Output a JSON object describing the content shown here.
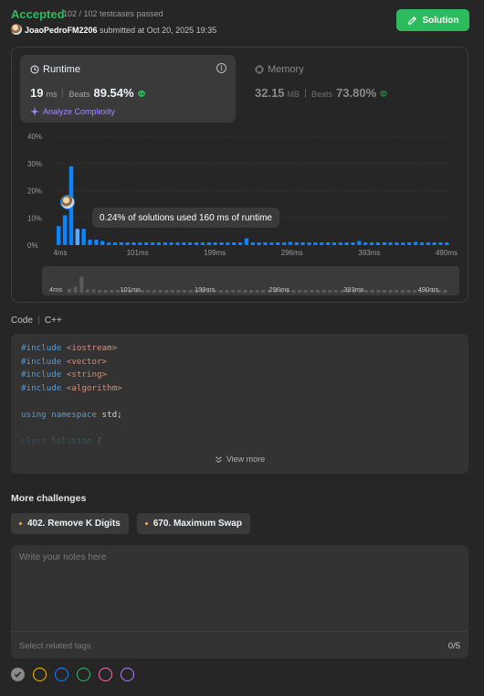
{
  "header": {
    "status": "Accepted",
    "testcases": "102 / 102 testcases passed",
    "username": "JoaoPedroFM2206",
    "submitted": "submitted at Oct 20, 2025 19:35",
    "solution_label": "Solution"
  },
  "runtime": {
    "title": "Runtime",
    "value": "19",
    "unit": "ms",
    "beats_label": "Beats",
    "beats": "89.54%",
    "analyze": "Analyze Complexity"
  },
  "memory": {
    "title": "Memory",
    "value": "32.15",
    "unit": "MB",
    "beats_label": "Beats",
    "beats": "73.80%"
  },
  "tooltip": "0.24% of solutions used 160 ms of runtime",
  "colors": {
    "accent_green": "#2cbb5d",
    "bar_blue": "#0a84ff",
    "purple": "#a78bfa"
  },
  "chart_data": {
    "type": "bar",
    "ylim": [
      0,
      40
    ],
    "y_ticks": [
      "40%",
      "30%",
      "20%",
      "10%",
      "0%"
    ],
    "x_ticks": [
      "4ms",
      "101ms",
      "199ms",
      "296ms",
      "393ms",
      "490ms"
    ],
    "mini_x_ticks": [
      "4ms",
      "101ms",
      "199ms",
      "296ms",
      "393ms",
      "490ms"
    ],
    "highlight_index": 3,
    "values": [
      7,
      11,
      29,
      6,
      6,
      2,
      2,
      1.5,
      1,
      1,
      1,
      1,
      1,
      1,
      1,
      1,
      1,
      1,
      1,
      1,
      1,
      1,
      1,
      1,
      1,
      1,
      1,
      1,
      1,
      1,
      2.5,
      1,
      1,
      1,
      1,
      1,
      1,
      1.2,
      1,
      1,
      1,
      1,
      1,
      1,
      1,
      1,
      1,
      1,
      1.5,
      1,
      1,
      1,
      1,
      1,
      1,
      1,
      1,
      1.2,
      1,
      1,
      1,
      1,
      1
    ]
  },
  "code": {
    "label": "Code",
    "language": "C++",
    "lines": [
      [
        {
          "t": "#include ",
          "c": "kw"
        },
        {
          "t": "<iostream>",
          "c": "inc"
        }
      ],
      [
        {
          "t": "#include ",
          "c": "kw"
        },
        {
          "t": "<vector>",
          "c": "inc"
        }
      ],
      [
        {
          "t": "#include ",
          "c": "kw"
        },
        {
          "t": "<string>",
          "c": "inc"
        }
      ],
      [
        {
          "t": "#include ",
          "c": "kw"
        },
        {
          "t": "<algorithm>",
          "c": "inc"
        }
      ],
      [],
      [
        {
          "t": "using ",
          "c": "kw"
        },
        {
          "t": "namespace ",
          "c": "kw"
        },
        {
          "t": "std;",
          "c": ""
        }
      ],
      [],
      [
        {
          "t": "class ",
          "c": "kw"
        },
        {
          "t": "Solution",
          "c": "cls"
        },
        {
          "t": " {",
          "c": ""
        }
      ]
    ],
    "view_more": "View more"
  },
  "challenges": {
    "title": "More challenges",
    "items": [
      "402. Remove K Digits",
      "670. Maximum Swap"
    ]
  },
  "notes": {
    "placeholder": "Write your notes here",
    "tags_placeholder": "Select related tags",
    "count": "0/5"
  },
  "note_colors": [
    "#8a8a8a",
    "#ffb800",
    "#0a84ff",
    "#2cbb5d",
    "#ff6ba8",
    "#b57bff"
  ]
}
